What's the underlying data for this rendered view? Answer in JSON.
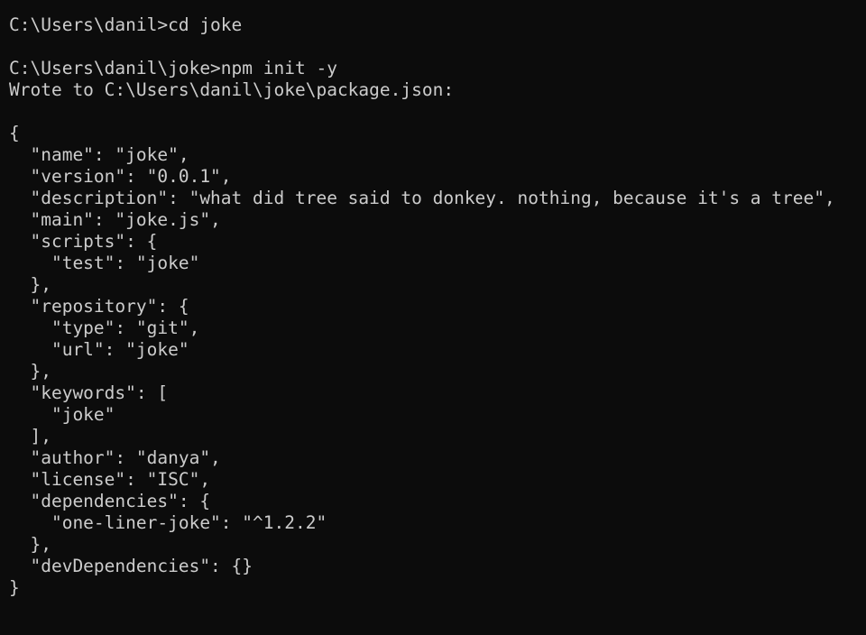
{
  "terminal": {
    "lines": [
      "C:\\Users\\danil>cd joke",
      "",
      "C:\\Users\\danil\\joke>npm init -y",
      "Wrote to C:\\Users\\danil\\joke\\package.json:",
      "",
      "{",
      "  \"name\": \"joke\",",
      "  \"version\": \"0.0.1\",",
      "  \"description\": \"what did tree said to donkey. nothing, because it's a tree\",",
      "  \"main\": \"joke.js\",",
      "  \"scripts\": {",
      "    \"test\": \"joke\"",
      "  },",
      "  \"repository\": {",
      "    \"type\": \"git\",",
      "    \"url\": \"joke\"",
      "  },",
      "  \"keywords\": [",
      "    \"joke\"",
      "  ],",
      "  \"author\": \"danya\",",
      "  \"license\": \"ISC\",",
      "  \"dependencies\": {",
      "    \"one-liner-joke\": \"^1.2.2\"",
      "  },",
      "  \"devDependencies\": {}",
      "}"
    ]
  },
  "colors": {
    "background": "#0c0c0c",
    "foreground": "#cccccc"
  }
}
